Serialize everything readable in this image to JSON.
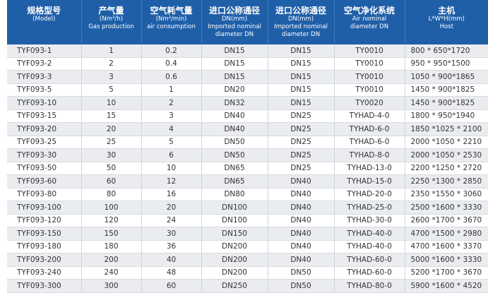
{
  "headers": [
    {
      "main": "规格型号",
      "sub": [
        "(Model)"
      ]
    },
    {
      "main": "产气量",
      "sub": [
        "(Nm³/h)",
        "Gas production"
      ]
    },
    {
      "main": "空气耗气量",
      "sub": [
        "(Nm³/min)",
        "air consumption"
      ]
    },
    {
      "main": "进口公称通径",
      "sub": [
        "DN(mm)",
        "Imported nominal",
        "diameter DN"
      ]
    },
    {
      "main": "进口公称通径",
      "sub": [
        "DN(mm)",
        "Imported nominal",
        "diameter DN"
      ]
    },
    {
      "main": "空气净化系统",
      "sub": [
        "Air nominal",
        "diameter DN"
      ]
    },
    {
      "main": "主机",
      "sub": [
        "L*W*H(mm)",
        "Host"
      ]
    }
  ],
  "rows": [
    [
      "TYF093-1",
      "1",
      "0.2",
      "DN15",
      "DN15",
      "TY0010",
      "800 * 650*1720"
    ],
    [
      "TYF093-2",
      "2",
      "0.4",
      "DN15",
      "DN15",
      "TY0010",
      "950 * 950*1500"
    ],
    [
      "TYF093-3",
      "3",
      "0.6",
      "DN15",
      "DN15",
      "TY0010",
      "1050 * 900*1865"
    ],
    [
      "TYF093-5",
      "5",
      "1",
      "DN20",
      "DN15",
      "TY0010",
      "1450 * 900*1825"
    ],
    [
      "TYF093-10",
      "10",
      "2",
      "DN32",
      "DN15",
      "TY0020",
      "1450 * 900*1825"
    ],
    [
      "TYF093-15",
      "15",
      "3",
      "DN40",
      "DN25",
      "TYHAD-4-0",
      "1800 * 950*1940"
    ],
    [
      "TYF093-20",
      "20",
      "4",
      "DN40",
      "DN25",
      "TYHAD-6-0",
      "1850 *1025 * 2100"
    ],
    [
      "TYF093-25",
      "25",
      "5",
      "DN50",
      "DN25",
      "TYHAD-6-0",
      "2000 *1050 * 2210"
    ],
    [
      "TYF093-30",
      "30",
      "6",
      "DN50",
      "DN25",
      "TYHAD-8-0",
      "2000 *1050 * 2530"
    ],
    [
      "TYF093-50",
      "50",
      "10",
      "DN65",
      "DN25",
      "TYHAD-13-0",
      "2200 *1250 * 2720"
    ],
    [
      "TYF093-60",
      "60",
      "12",
      "DN65",
      "DN40",
      "TYHAD-15-0",
      "2250 *1300 * 2850"
    ],
    [
      "TYF093-80",
      "80",
      "16",
      "DN80",
      "DN40",
      "TYHAD-20-0",
      "2350 *1550 * 3060"
    ],
    [
      "TYF093-100",
      "100",
      "20",
      "DN100",
      "DN40",
      "TYHAD-25-0",
      "2500 *1600 * 3330"
    ],
    [
      "TYF093-120",
      "120",
      "24",
      "DN100",
      "DN40",
      "TYHAD-30-0",
      "2600 *1700 * 3670"
    ],
    [
      "TYF093-150",
      "150",
      "30",
      "DN150",
      "DN40",
      "TYHAD-40-0",
      "4700 *1500 * 2980"
    ],
    [
      "TYF093-180",
      "180",
      "36",
      "DN200",
      "DN40",
      "TYHAD-40-0",
      "4700 *1600 * 3370"
    ],
    [
      "TYF093-200",
      "200",
      "40",
      "DN200",
      "DN40",
      "TYHAD-60-0",
      "5000 *1600 * 3330"
    ],
    [
      "TYF093-240",
      "240",
      "48",
      "DN200",
      "DN50",
      "TYHAD-60-0",
      "5200 *1700 * 3670"
    ],
    [
      "TYF093-300",
      "300",
      "60",
      "DN250",
      "DN50",
      "TYHAD-80-0",
      "5900 *1600 * 4520"
    ]
  ],
  "colors": {
    "header_bg": "#1f5fa8",
    "row_stripe": "#eaecef"
  }
}
